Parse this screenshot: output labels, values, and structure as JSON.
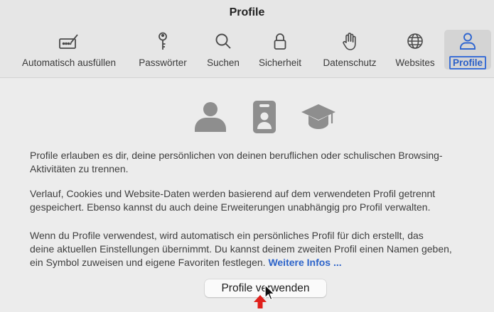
{
  "window": {
    "title": "Profile"
  },
  "tabs": [
    {
      "label": "Automatisch ausfüllen",
      "icon": "autofill-icon"
    },
    {
      "label": "Passwörter",
      "icon": "key-icon"
    },
    {
      "label": "Suchen",
      "icon": "search-icon"
    },
    {
      "label": "Sicherheit",
      "icon": "lock-icon"
    },
    {
      "label": "Datenschutz",
      "icon": "hand-icon"
    },
    {
      "label": "Websites",
      "icon": "globe-icon"
    },
    {
      "label": "Profile",
      "icon": "person-icon",
      "active": true
    }
  ],
  "content": {
    "icons": [
      "person-icon",
      "badge-icon",
      "graduation-cap-icon"
    ],
    "para1_line1": "Profile erlauben es dir, deine persönlichen von deinen beruflichen oder schulischen Browsing-",
    "para1_line2": "Aktivitäten zu trennen.",
    "para2_line1": "Verlauf, Cookies und Website-Daten werden basierend auf dem verwendeten Profil getrennt",
    "para2_line2": "gespeichert. Ebenso kannst du auch deine Erweiterungen unabhängig pro Profil verwalten.",
    "para3_line1": "Wenn du Profile verwendest, wird automatisch ein persönliches Profil für dich erstellt, das",
    "para3_line2": "deine aktuellen Einstellungen übernimmt. Du kannst deinem zweiten Profil einen Namen geben,",
    "para3_line3": "ein Symbol zuweisen und eigene Favoriten festlegen.",
    "more_link": "Weitere Infos ...",
    "button_label": "Profile verwenden"
  },
  "colors": {
    "accent": "#2c63c9",
    "annotation_arrow": "#e0201b",
    "icon_gray": "#8e8e8e"
  }
}
